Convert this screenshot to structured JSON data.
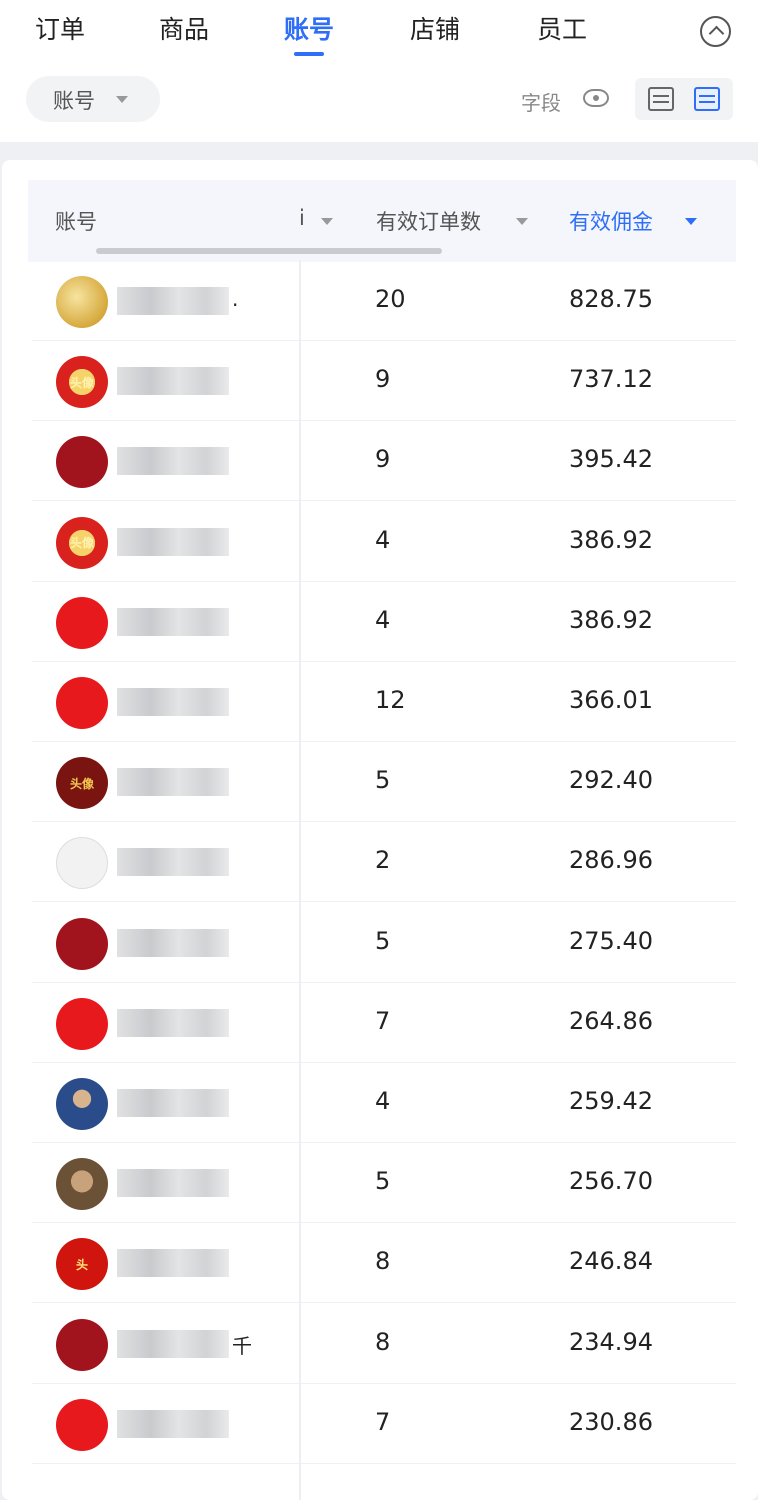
{
  "tabs": [
    {
      "label": "订单",
      "active": false
    },
    {
      "label": "商品",
      "active": false
    },
    {
      "label": "账号",
      "active": true
    },
    {
      "label": "店铺",
      "active": false
    },
    {
      "label": "员工",
      "active": false
    }
  ],
  "filter": {
    "label": "账号"
  },
  "toolbar": {
    "field_label": "字段"
  },
  "table": {
    "columns": {
      "account": "账号",
      "partial": "i",
      "valid_orders": "有效订单数",
      "valid_commission": "有效佣金"
    },
    "sorted_column": "valid_commission",
    "rows": [
      {
        "avatar": "gold-logo",
        "avatar_text": "",
        "valid_orders": "20",
        "valid_commission": "828.75"
      },
      {
        "avatar": "red-banner",
        "avatar_text": "头像",
        "valid_orders": "9",
        "valid_commission": "737.12"
      },
      {
        "avatar": "dark-red-seal",
        "avatar_text": "",
        "valid_orders": "9",
        "valid_commission": "395.42"
      },
      {
        "avatar": "red-banner",
        "avatar_text": "头像",
        "valid_orders": "4",
        "valid_commission": "386.92"
      },
      {
        "avatar": "red-seal",
        "avatar_text": "",
        "valid_orders": "4",
        "valid_commission": "386.92"
      },
      {
        "avatar": "red-seal",
        "avatar_text": "",
        "valid_orders": "12",
        "valid_commission": "366.01"
      },
      {
        "avatar": "maroon-seal",
        "avatar_text": "头像",
        "valid_orders": "5",
        "valid_commission": "292.40"
      },
      {
        "avatar": "blank",
        "avatar_text": "",
        "valid_orders": "2",
        "valid_commission": "286.96"
      },
      {
        "avatar": "dark-red-seal",
        "avatar_text": "",
        "valid_orders": "5",
        "valid_commission": "275.40"
      },
      {
        "avatar": "red-seal",
        "avatar_text": "",
        "valid_orders": "7",
        "valid_commission": "264.86"
      },
      {
        "avatar": "photo-blue",
        "avatar_text": "",
        "valid_orders": "4",
        "valid_commission": "259.42"
      },
      {
        "avatar": "photo-brown",
        "avatar_text": "",
        "valid_orders": "5",
        "valid_commission": "256.70"
      },
      {
        "avatar": "red-head",
        "avatar_text": "头",
        "valid_orders": "8",
        "valid_commission": "246.84"
      },
      {
        "avatar": "dark-red-seal",
        "avatar_text": "",
        "valid_orders": "8",
        "valid_commission": "234.94"
      },
      {
        "avatar": "red-seal",
        "avatar_text": "",
        "valid_orders": "7",
        "valid_commission": "230.86"
      }
    ],
    "row_name_fragments": [
      ".",
      "",
      "",
      "",
      "",
      "",
      "",
      "",
      "",
      "",
      "",
      "",
      "",
      "千",
      ""
    ]
  }
}
